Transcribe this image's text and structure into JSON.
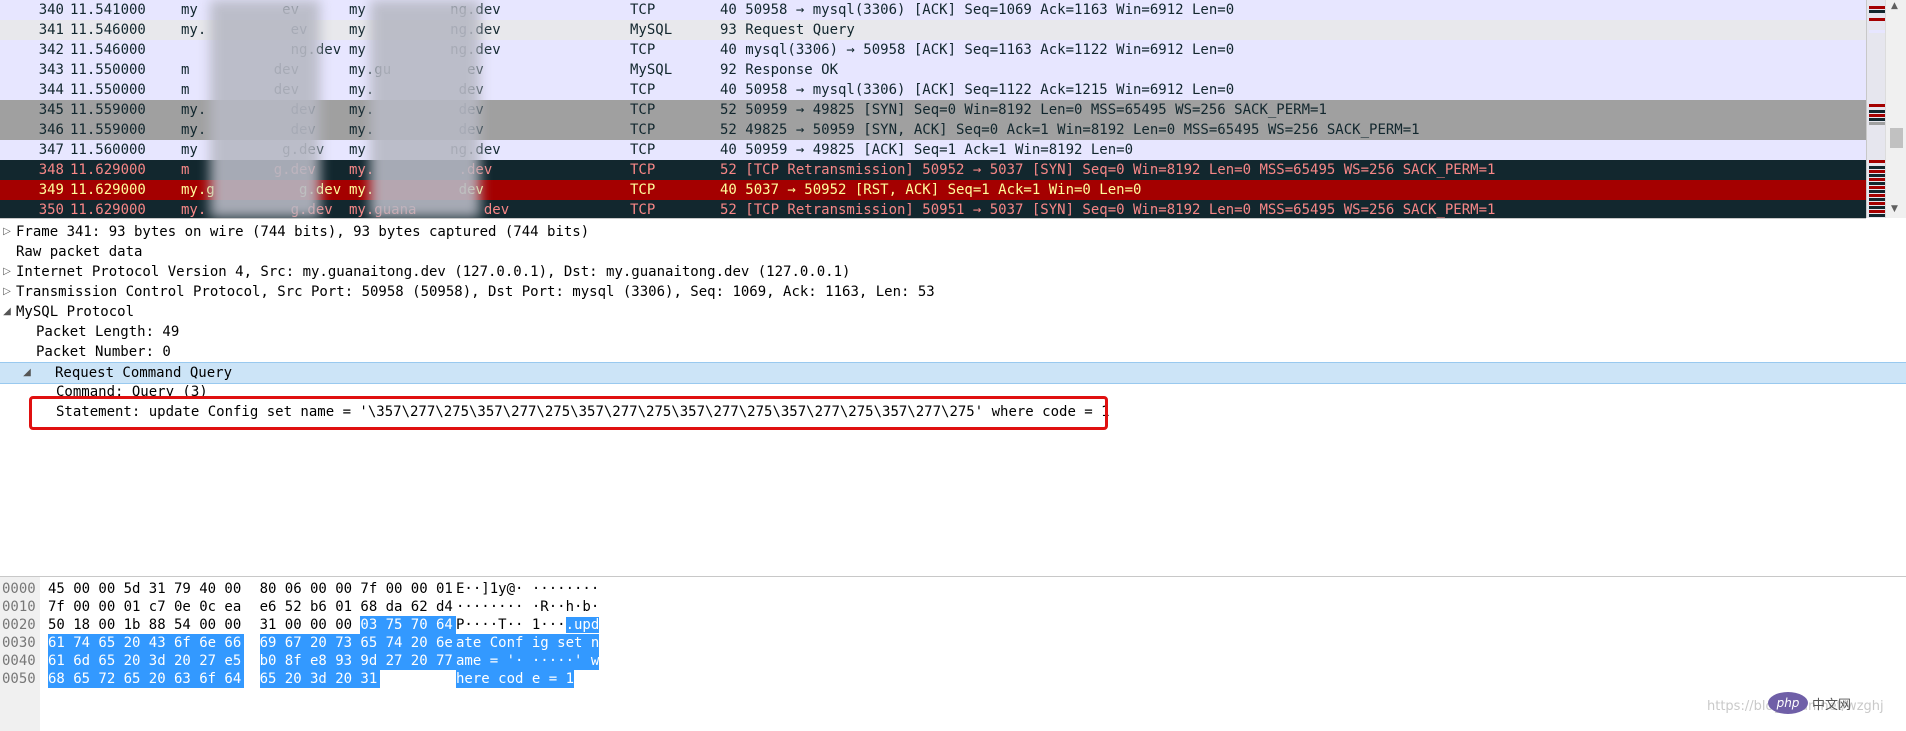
{
  "packets": [
    {
      "no": "340",
      "time": "11.541000",
      "src": "my          ev",
      "dst": "my          ng.dev",
      "proto": "TCP",
      "info": "40 50958 → mysql(3306) [ACK] Seq=1069 Ack=1163 Win=6912 Len=0",
      "style": "tcp"
    },
    {
      "no": "341",
      "time": "11.546000",
      "src": "my.          ev",
      "dst": "my          ng.dev",
      "proto": "MySQL",
      "info": "93 Request Query",
      "style": "mysql"
    },
    {
      "no": "342",
      "time": "11.546000",
      "src": "             ng.dev",
      "dst": "my          ng.dev",
      "proto": "TCP",
      "info": "40 mysql(3306) → 50958 [ACK] Seq=1163 Ack=1122 Win=6912 Len=0",
      "style": "tcp"
    },
    {
      "no": "343",
      "time": "11.550000",
      "src": "m          dev",
      "dst": "my.gu         ev",
      "proto": "MySQL",
      "info": "92 Response OK",
      "style": "mysql"
    },
    {
      "no": "344",
      "time": "11.550000",
      "src": "m          dev",
      "dst": "my.          dev",
      "proto": "TCP",
      "info": "40 50958 → mysql(3306) [ACK] Seq=1122 Ack=1215 Win=6912 Len=0",
      "style": "tcp"
    },
    {
      "no": "345",
      "time": "11.559000",
      "src": "my.          dev",
      "dst": "my.          dev",
      "proto": "TCP",
      "info": "52 50959 → 49825 [SYN] Seq=0 Win=8192 Len=0 MSS=65495 WS=256 SACK_PERM=1",
      "style": "syn"
    },
    {
      "no": "346",
      "time": "11.559000",
      "src": "my.          dev",
      "dst": "my.          dev",
      "proto": "TCP",
      "info": "52 49825 → 50959 [SYN, ACK] Seq=0 Ack=1 Win=8192 Len=0 MSS=65495 WS=256 SACK_PERM=1",
      "style": "syn"
    },
    {
      "no": "347",
      "time": "11.560000",
      "src": "my          g.dev",
      "dst": "my          ng.dev",
      "proto": "TCP",
      "info": "40 50959 → 49825 [ACK] Seq=1 Ack=1 Win=8192 Len=0",
      "style": "tcp"
    },
    {
      "no": "348",
      "time": "11.629000",
      "src": "m          g.dev",
      "dst": "my.          .dev",
      "proto": "TCP",
      "info": "52 [TCP Retransmission] 50952 → 5037 [SYN] Seq=0 Win=8192 Len=0 MSS=65495 WS=256 SACK_PERM=1",
      "style": "dark"
    },
    {
      "no": "349",
      "time": "11.629000",
      "src": "my.g          g.dev",
      "dst": "my.          dev",
      "proto": "TCP",
      "info": "40 5037 → 50952 [RST, ACK] Seq=1 Ack=1 Win=0 Len=0",
      "style": "rst"
    },
    {
      "no": "350",
      "time": "11.629000",
      "src": "my.          g.dev",
      "dst": "my.guana        dev",
      "proto": "TCP",
      "info": "52 [TCP Retransmission] 50951 → 5037 [SYN] Seq=0 Win=8192 Len=0 MSS=65495 WS=256 SACK_PERM=1",
      "style": "dark"
    }
  ],
  "row_styles": {
    "tcp": {
      "bg": "#e7e6ff",
      "fg": "#12272e"
    },
    "mysql": {
      "bg": "#e7e6ff",
      "fg": "#12272e"
    },
    "selected": {
      "bg": "#e8e8e8",
      "fg": "#12272e"
    },
    "syn": {
      "bg": "#a0a0a0",
      "fg": "#12272e"
    },
    "dark": {
      "bg": "#12272e",
      "fg": "#f78787"
    },
    "rst": {
      "bg": "#a40000",
      "fg": "#fffc9c"
    }
  },
  "details": [
    {
      "twisty": "▷",
      "indent": 0,
      "text": "Frame 341: 93 bytes on wire (744 bits), 93 bytes captured (744 bits)"
    },
    {
      "twisty": "",
      "indent": 0,
      "text": "Raw packet data"
    },
    {
      "twisty": "▷",
      "indent": 0,
      "text": "Internet Protocol Version 4, Src: my.guanaitong.dev (127.0.0.1), Dst: my.guanaitong.dev (127.0.0.1)"
    },
    {
      "twisty": "▷",
      "indent": 0,
      "text": "Transmission Control Protocol, Src Port: 50958 (50958), Dst Port: mysql (3306), Seq: 1069, Ack: 1163, Len: 53"
    },
    {
      "twisty": "◢",
      "indent": 0,
      "text": "MySQL Protocol"
    },
    {
      "twisty": "",
      "indent": 1,
      "text": "Packet Length: 49"
    },
    {
      "twisty": "",
      "indent": 1,
      "text": "Packet Number: 0"
    },
    {
      "twisty": "◢",
      "indent": 1,
      "text": "Request Command Query",
      "selected": true
    },
    {
      "twisty": "",
      "indent": 2,
      "text": "Command: Query (3)"
    },
    {
      "twisty": "",
      "indent": 2,
      "text": "Statement: update Config set name = '\\357\\277\\275\\357\\277\\275\\357\\277\\275\\357\\277\\275\\357\\277\\275\\357\\277\\275' where code = 1"
    }
  ],
  "hex": [
    {
      "offset": "0000",
      "bytes": [
        "45",
        "00",
        "00",
        "5d",
        "31",
        "79",
        "40",
        "00",
        "80",
        "06",
        "00",
        "00",
        "7f",
        "00",
        "00",
        "01"
      ],
      "ascii": "E··]1y@· ········",
      "hl_start": 16
    },
    {
      "offset": "0010",
      "bytes": [
        "7f",
        "00",
        "00",
        "01",
        "c7",
        "0e",
        "0c",
        "ea",
        "e6",
        "52",
        "b6",
        "01",
        "68",
        "da",
        "62",
        "d4"
      ],
      "ascii": "········ ·R··h·b·",
      "hl_start": 16
    },
    {
      "offset": "0020",
      "bytes": [
        "50",
        "18",
        "00",
        "1b",
        "88",
        "54",
        "00",
        "00",
        "31",
        "00",
        "00",
        "00",
        "03",
        "75",
        "70",
        "64"
      ],
      "ascii": "P····T·· 1···.upd",
      "hl_start": 12
    },
    {
      "offset": "0030",
      "bytes": [
        "61",
        "74",
        "65",
        "20",
        "43",
        "6f",
        "6e",
        "66",
        "69",
        "67",
        "20",
        "73",
        "65",
        "74",
        "20",
        "6e"
      ],
      "ascii": "ate Conf ig set n",
      "hl_start": 0
    },
    {
      "offset": "0040",
      "bytes": [
        "61",
        "6d",
        "65",
        "20",
        "3d",
        "20",
        "27",
        "e5",
        "b0",
        "8f",
        "e8",
        "93",
        "9d",
        "27",
        "20",
        "77"
      ],
      "ascii": "ame = '· ·····' w",
      "hl_start": 0
    },
    {
      "offset": "0050",
      "bytes": [
        "68",
        "65",
        "72",
        "65",
        "20",
        "63",
        "6f",
        "64",
        "65",
        "20",
        "3d",
        "20",
        "31"
      ],
      "ascii": "here cod e = 1",
      "hl_start": 0
    }
  ],
  "watermark": "https://blog.csdn.net/wzghj",
  "php_logo": "php",
  "php_text": "中文网"
}
